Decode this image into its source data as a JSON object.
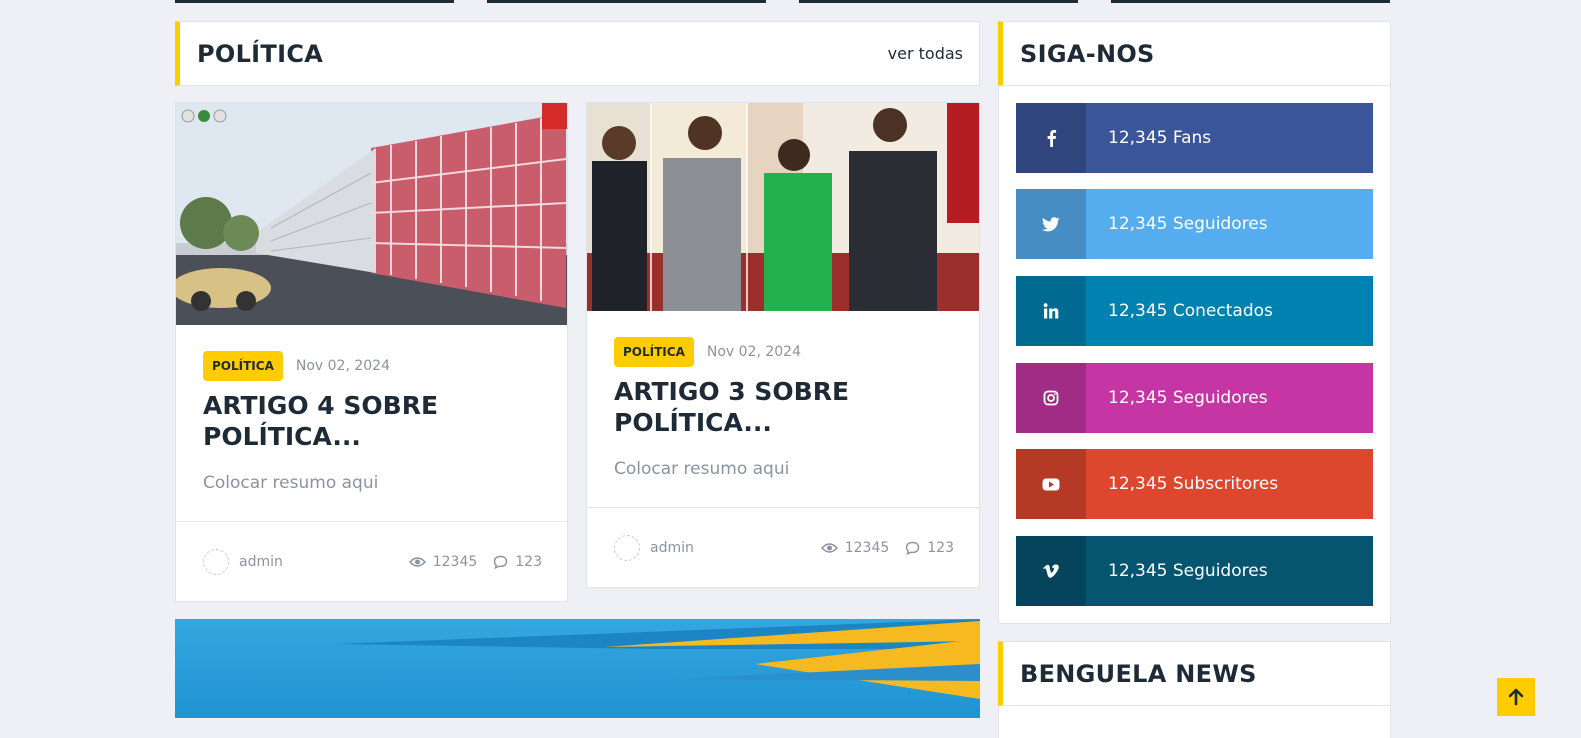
{
  "politica": {
    "heading": "POLÍTICA",
    "view_all": "ver todas"
  },
  "articles": [
    {
      "category": "POLÍTICA",
      "date": "Nov 02, 2024",
      "title": "ARTIGO 4 SOBRE POLÍTICA...",
      "summary": "Colocar resumo aqui",
      "author": "admin",
      "views": "12345",
      "comments": "123",
      "image": "architectural rendering of red modernist building"
    },
    {
      "category": "POLÍTICA",
      "date": "Nov 02, 2024",
      "title": "ARTIGO 3 SOBRE POLÍTICA...",
      "summary": "Colocar resumo aqui",
      "author": "admin",
      "views": "12345",
      "comments": "123",
      "image": "officials shaking hands in formal room"
    }
  ],
  "follow": {
    "heading": "SIGA-NOS",
    "items": [
      {
        "icon": "facebook-icon",
        "label": "12,345 Fans",
        "color": "#3b5599"
      },
      {
        "icon": "twitter-icon",
        "label": "12,345 Seguidores",
        "color": "#55acee"
      },
      {
        "icon": "linkedin-icon",
        "label": "12,345 Conectados",
        "color": "#0082b1"
      },
      {
        "icon": "instagram-icon",
        "label": "12,345 Seguidores",
        "color": "#c536a4"
      },
      {
        "icon": "youtube-icon",
        "label": "12,345 Subscritores",
        "color": "#dc472e"
      },
      {
        "icon": "vimeo-icon",
        "label": "12,345 Seguidores",
        "color": "#055570"
      }
    ]
  },
  "benguela": {
    "heading": "BENGUELA NEWS"
  },
  "colors": {
    "accent": "#ffcc00",
    "heading": "#1e2b37",
    "muted": "#8a94a0",
    "background": "#eef0f5"
  }
}
